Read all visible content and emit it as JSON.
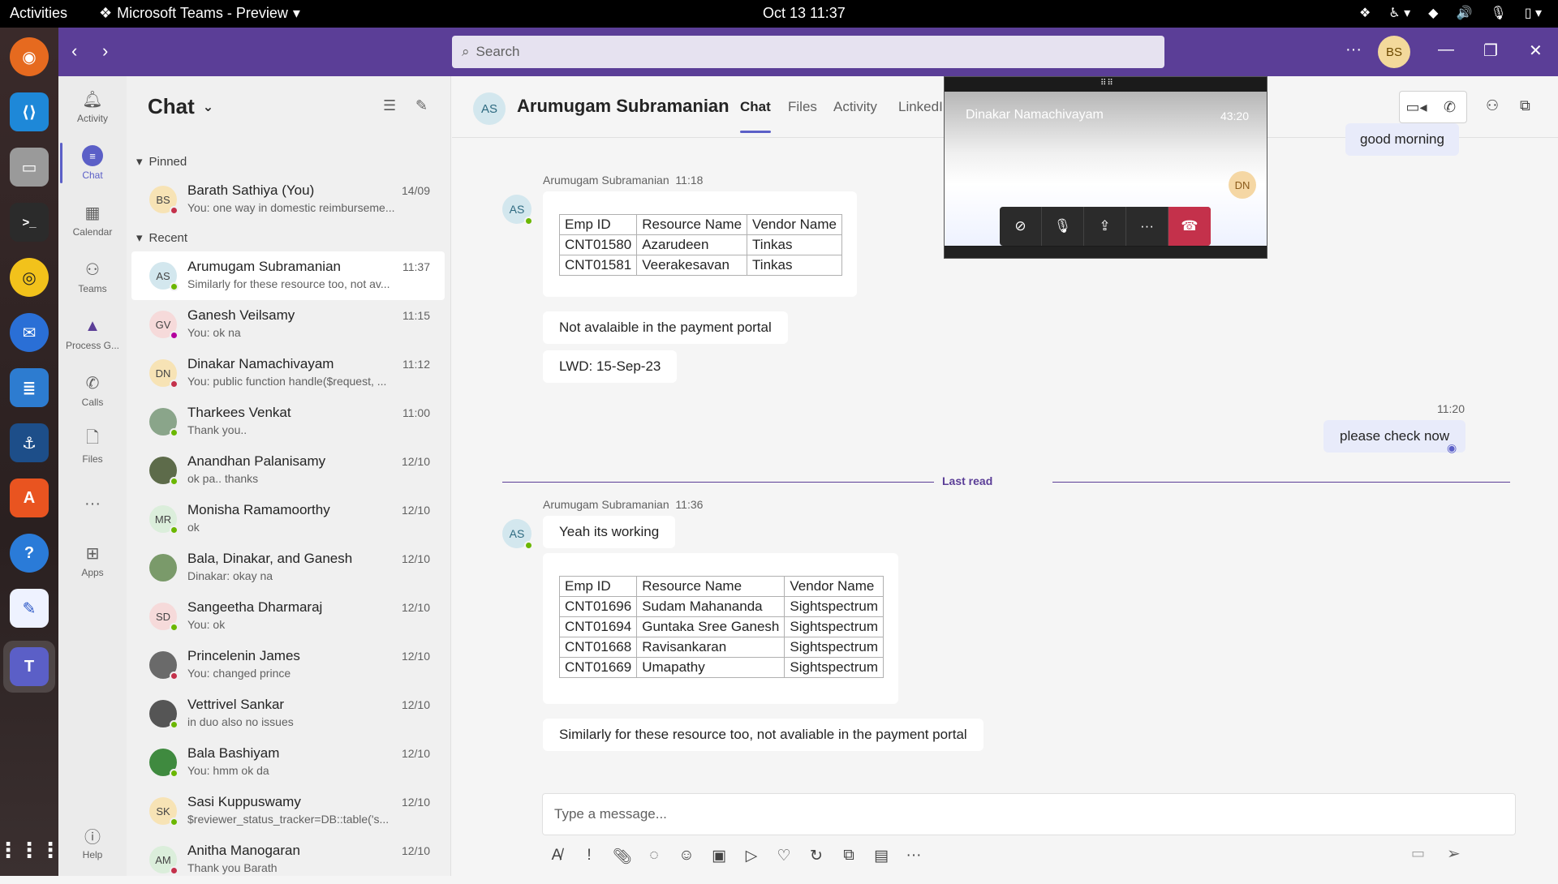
{
  "os": {
    "activities": "Activities",
    "app_title": "Microsoft Teams - Preview",
    "clock": "Oct 13  11:37"
  },
  "titlebar": {
    "search_placeholder": "Search",
    "me_initials": "BS"
  },
  "rail": [
    {
      "label": "Activity",
      "icon": "bell-icon"
    },
    {
      "label": "Chat",
      "icon": "chat-icon"
    },
    {
      "label": "Calendar",
      "icon": "calendar-icon"
    },
    {
      "label": "Teams",
      "icon": "teams-icon"
    },
    {
      "label": "Process G...",
      "icon": "process-icon"
    },
    {
      "label": "Calls",
      "icon": "phone-icon"
    },
    {
      "label": "Files",
      "icon": "file-icon"
    },
    {
      "label": "Apps",
      "icon": "apps-icon"
    },
    {
      "label": "Help",
      "icon": "help-icon"
    }
  ],
  "chatlist": {
    "title": "Chat",
    "pinned_label": "Pinned",
    "recent_label": "Recent",
    "pinned": [
      {
        "initials": "BS",
        "name": "Barath Sathiya (You)",
        "time": "14/09",
        "preview": "You: one way in domestic reimburseme...",
        "avatar_bg": "#f7e3b5",
        "status": "#c4314b"
      }
    ],
    "recent": [
      {
        "initials": "AS",
        "name": "Arumugam Subramanian",
        "time": "11:37",
        "preview": "Similarly for these resource too, not av...",
        "avatar_bg": "#d3e7ee",
        "status": "#6bb700"
      },
      {
        "initials": "GV",
        "name": "Ganesh Veilsamy",
        "time": "11:15",
        "preview": "You: ok na",
        "avatar_bg": "#f6dada",
        "status": "#b4009e"
      },
      {
        "initials": "DN",
        "name": "Dinakar Namachivayam",
        "time": "11:12",
        "preview": "You: public function handle($request, ...",
        "avatar_bg": "#f7e3b5",
        "status": "#c4314b"
      },
      {
        "initials": "",
        "name": "Tharkees Venkat",
        "time": "11:00",
        "preview": "Thank you..",
        "avatar_bg": "#8aa58a",
        "status": "#6bb700"
      },
      {
        "initials": "",
        "name": "Anandhan Palanisamy",
        "time": "12/10",
        "preview": "ok pa.. thanks",
        "avatar_bg": "#5d6b4a",
        "status": "#6bb700"
      },
      {
        "initials": "MR",
        "name": "Monisha Ramamoorthy",
        "time": "12/10",
        "preview": "ok",
        "avatar_bg": "#dbeedb",
        "status": "#6bb700"
      },
      {
        "initials": "",
        "name": "Bala, Dinakar, and Ganesh",
        "time": "12/10",
        "preview": "Dinakar: okay na",
        "avatar_bg": "#7a9a6a",
        "status": ""
      },
      {
        "initials": "SD",
        "name": "Sangeetha Dharmaraj",
        "time": "12/10",
        "preview": "You: ok",
        "avatar_bg": "#f6dada",
        "status": "#6bb700"
      },
      {
        "initials": "",
        "name": "Princelenin James",
        "time": "12/10",
        "preview": "You: changed prince",
        "avatar_bg": "#6a6a6a",
        "status": "#c4314b"
      },
      {
        "initials": "",
        "name": "Vettrivel Sankar",
        "time": "12/10",
        "preview": "in duo also no issues",
        "avatar_bg": "#555555",
        "status": "#6bb700"
      },
      {
        "initials": "",
        "name": "Bala Bashiyam",
        "time": "12/10",
        "preview": "You: hmm ok da",
        "avatar_bg": "#3f8a3f",
        "status": "#6bb700"
      },
      {
        "initials": "SK",
        "name": "Sasi Kuppuswamy",
        "time": "12/10",
        "preview": "$reviewer_status_tracker=DB::table('s...",
        "avatar_bg": "#f7e3b5",
        "status": "#6bb700"
      },
      {
        "initials": "AM",
        "name": "Anitha Manogaran",
        "time": "12/10",
        "preview": "Thank you Barath",
        "avatar_bg": "#dbeedb",
        "status": "#c4314b"
      }
    ]
  },
  "conversation": {
    "initials": "AS",
    "name": "Arumugam Subramanian",
    "tabs": [
      "Chat",
      "Files",
      "Activity",
      "LinkedI"
    ],
    "good_morning": "good morning",
    "msg1": {
      "sender": "Arumugam Subramanian",
      "time": "11:18",
      "table_header": [
        "Emp ID",
        "Resource Name",
        "Vendor Name"
      ],
      "table_rows": [
        [
          "CNT01580",
          "Azarudeen",
          "Tinkas"
        ],
        [
          "CNT01581",
          "Veerakesavan",
          "Tinkas"
        ]
      ],
      "text1": "Not avalaible in the payment portal",
      "text2": "LWD: 15-Sep-23"
    },
    "mine": {
      "time": "11:20",
      "text": "please check now"
    },
    "last_read": "Last read",
    "msg2": {
      "sender": "Arumugam Subramanian",
      "time": "11:36",
      "text1": "Yeah its working",
      "table_header": [
        "Emp ID",
        "Resource Name",
        "Vendor Name"
      ],
      "table_rows": [
        [
          "CNT01696",
          "Sudam Mahananda",
          "Sightspectrum"
        ],
        [
          "CNT01694",
          "Guntaka Sree Ganesh",
          "Sightspectrum"
        ],
        [
          "CNT01668",
          "Ravisankaran",
          "Sightspectrum"
        ],
        [
          "CNT01669",
          "Umapathy",
          "Sightspectrum"
        ]
      ],
      "text2": "Similarly for these resource too, not avaliable in the payment portal"
    },
    "compose_placeholder": "Type a message..."
  },
  "call": {
    "name": "Dinakar Namachivayam",
    "duration": "43:20",
    "initials": "DN"
  }
}
